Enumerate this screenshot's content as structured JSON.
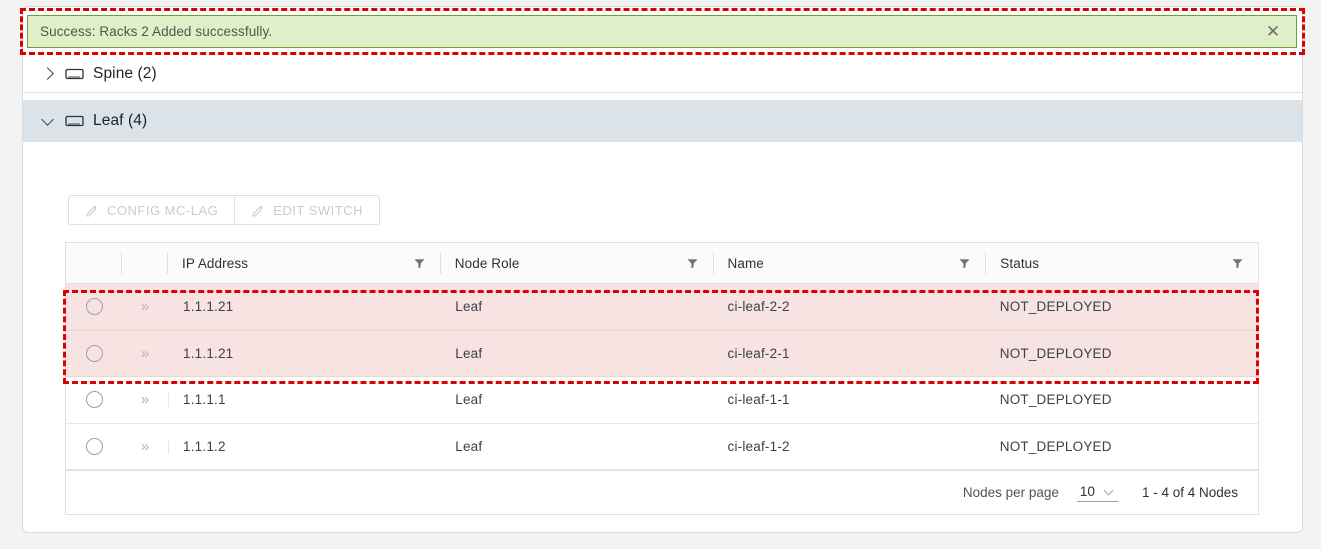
{
  "banner": {
    "message": "Success: Racks 2 Added successfully.",
    "close_icon": "close-icon",
    "bg_color": "#dff0c9",
    "border_color": "#6a9e3a"
  },
  "sections": [
    {
      "label": "Spine (2)",
      "expanded": false,
      "chevron_icon": "chevron-right-icon",
      "device_icon": "switch-icon"
    },
    {
      "label": "Leaf (4)",
      "expanded": true,
      "chevron_icon": "chevron-down-icon",
      "device_icon": "switch-icon",
      "header_color": "#dbe3e8"
    }
  ],
  "toolbar": {
    "buttons": [
      {
        "label": "CONFIG MC-LAG",
        "icon": "pencil-icon",
        "disabled": true
      },
      {
        "label": "EDIT SWITCH",
        "icon": "pencil-icon",
        "disabled": true
      }
    ]
  },
  "table": {
    "columns": [
      {
        "label": "IP Address",
        "filter_icon": "filter-icon"
      },
      {
        "label": "Node Role",
        "filter_icon": "filter-icon"
      },
      {
        "label": "Name",
        "filter_icon": "filter-icon"
      },
      {
        "label": "Status",
        "filter_icon": "filter-icon"
      }
    ],
    "rows": [
      {
        "ip": "1.1.1.21",
        "role": "Leaf",
        "name": "ci-leaf-2-2",
        "status": "NOT_DEPLOYED",
        "highlighted": true,
        "selected": false,
        "expand_icon": "expand-chevrons-icon"
      },
      {
        "ip": "1.1.1.21",
        "role": "Leaf",
        "name": "ci-leaf-2-1",
        "status": "NOT_DEPLOYED",
        "highlighted": true,
        "selected": false,
        "expand_icon": "expand-chevrons-icon"
      },
      {
        "ip": "1.1.1.1",
        "role": "Leaf",
        "name": "ci-leaf-1-1",
        "status": "NOT_DEPLOYED",
        "highlighted": false,
        "selected": false,
        "expand_icon": "expand-chevrons-icon"
      },
      {
        "ip": "1.1.1.2",
        "role": "Leaf",
        "name": "ci-leaf-1-2",
        "status": "NOT_DEPLOYED",
        "highlighted": false,
        "selected": false,
        "expand_icon": "expand-chevrons-icon"
      }
    ],
    "expand_glyph": "»",
    "highlight_color": "#f8e3e3"
  },
  "footer": {
    "per_page_label": "Nodes per page",
    "per_page_value": "10",
    "chevron_icon": "chevron-down-icon",
    "range_text": "1 - 4 of 4 Nodes"
  },
  "annotations": {
    "color": "#dd0000",
    "boxes": [
      "success-banner",
      "newly-added-rows"
    ]
  }
}
